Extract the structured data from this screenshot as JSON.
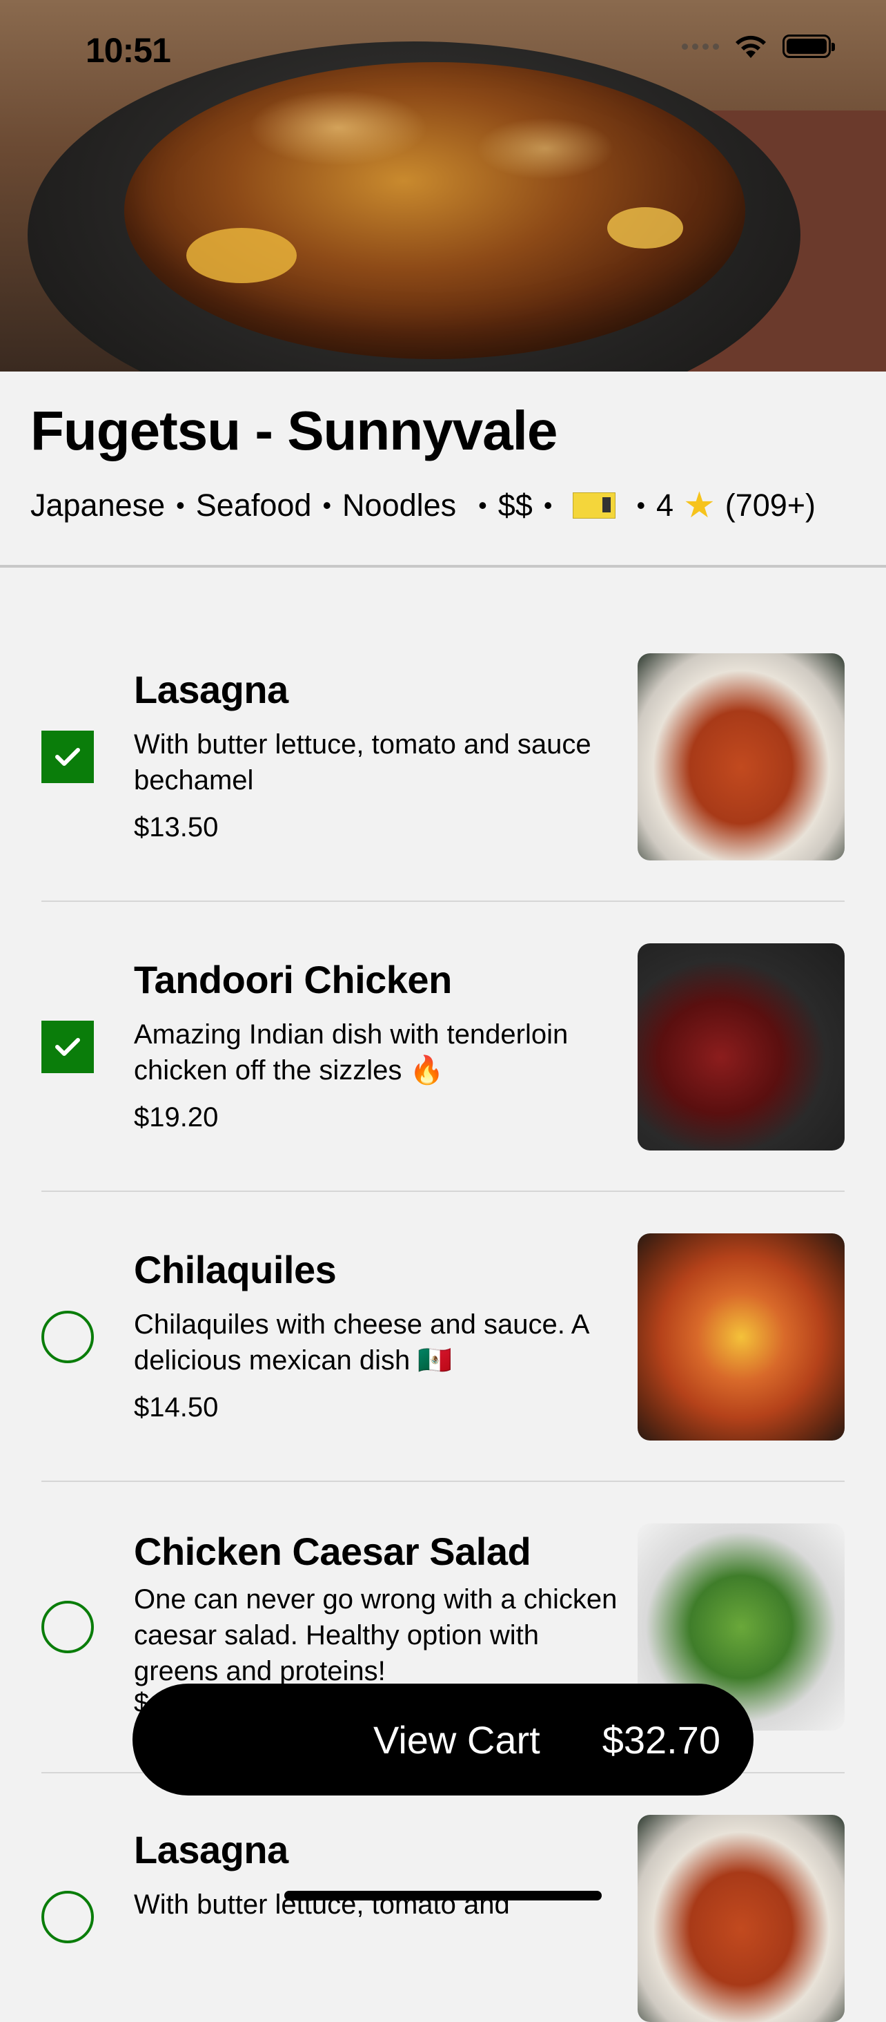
{
  "status_bar": {
    "time": "10:51"
  },
  "restaurant": {
    "name": "Fugetsu - Sunnyvale",
    "cuisines": [
      "Japanese",
      "Seafood",
      "Noodles"
    ],
    "price_level": "$$",
    "rating": "4",
    "reviews": "(709+)",
    "icons": [
      "concert-ticket-icon",
      "star-icon"
    ]
  },
  "menu": {
    "items": [
      {
        "title": "Lasagna",
        "description": "With butter lettuce, tomato and sauce bechamel",
        "price": "$13.50",
        "checked": true,
        "image": "lasagna-photo"
      },
      {
        "title": "Tandoori Chicken",
        "description": "Amazing Indian dish with tenderloin chicken off the sizzles 🔥",
        "price": "$19.20",
        "checked": true,
        "image": "tandoori-chicken-photo"
      },
      {
        "title": "Chilaquiles",
        "description": "Chilaquiles with cheese and sauce. A delicious mexican dish 🇲🇽",
        "price": "$14.50",
        "checked": false,
        "image": "chilaquiles-photo"
      },
      {
        "title": "Chicken Caesar Salad",
        "description": "One can never go wrong with a chicken caesar salad. Healthy option with greens and proteins!",
        "price": "$",
        "checked": false,
        "image": "caesar-salad-photo"
      },
      {
        "title": "Lasagna",
        "description": "With butter lettuce, tomato and",
        "price": "",
        "checked": false,
        "image": "lasagna-photo"
      }
    ]
  },
  "cart": {
    "label": "View Cart",
    "total": "$32.70"
  },
  "colors": {
    "accent_green": "#0a7d0a",
    "cart_bg": "#000000",
    "background": "#f2f2f2"
  }
}
